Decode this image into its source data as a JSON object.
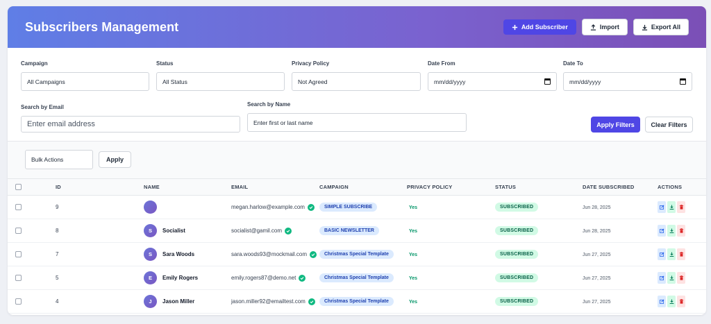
{
  "header": {
    "title": "Subscribers Management",
    "add_label": "Add Subscriber",
    "import_label": "Import",
    "export_label": "Export All"
  },
  "filters": {
    "campaign_label": "Campaign",
    "campaign_value": "All Campaigns",
    "status_label": "Status",
    "status_value": "All Status",
    "privacy_label": "Privacy Policy",
    "privacy_value": "Not Agreed",
    "date_from_label": "Date From",
    "date_from_value": "mm/dd/yyyy",
    "date_to_label": "Date To",
    "date_to_value": "mm/dd/yyyy",
    "email_label": "Search by Email",
    "email_placeholder": "Enter email address",
    "name_label": "Search by Name",
    "name_placeholder": "Enter first or last name",
    "apply_label": "Apply Filters",
    "clear_label": "Clear Filters"
  },
  "bulk": {
    "select_value": "Bulk Actions",
    "apply_label": "Apply"
  },
  "table": {
    "columns": [
      "ID",
      "NAME",
      "EMAIL",
      "CAMPAIGN",
      "PRIVACY POLICY",
      "STATUS",
      "DATE SUBSCRIBED",
      "ACTIONS"
    ],
    "rows": [
      {
        "id": "9",
        "initial": "",
        "name": "",
        "email": "megan.harlow@example.com",
        "campaign": "SIMPLE SUBSCRIBE",
        "privacy": "Yes",
        "status": "SUBSCRIBED",
        "date": "Jun 28, 2025"
      },
      {
        "id": "8",
        "initial": "S",
        "name": "Socialist",
        "email": "socialist@gamil.com",
        "campaign": "BASIC NEWSLETTER",
        "privacy": "Yes",
        "status": "SUBSCRIBED",
        "date": "Jun 28, 2025"
      },
      {
        "id": "7",
        "initial": "S",
        "name": "Sara Woods",
        "email": "sara.woods93@mockmail.com",
        "campaign": "Christmas Special Template",
        "privacy": "Yes",
        "status": "SUBSCRIBED",
        "date": "Jun 27, 2025"
      },
      {
        "id": "5",
        "initial": "E",
        "name": "Emily Rogers",
        "email": "emily.rogers87@demo.net",
        "campaign": "Christmas Special Template",
        "privacy": "Yes",
        "status": "SUBSCRIBED",
        "date": "Jun 27, 2025"
      },
      {
        "id": "4",
        "initial": "J",
        "name": "Jason Miller",
        "email": "jason.miller92@emailtest.com",
        "campaign": "Christmas Special Template",
        "privacy": "Yes",
        "status": "SUBSCRIBED",
        "date": "Jun 27, 2025"
      }
    ]
  },
  "colors": {
    "primary": "#4f46e5",
    "header_start": "#5f7ee6",
    "header_end": "#7b4fb6",
    "success": "#10b981"
  },
  "icons": [
    "plus-icon",
    "upload-icon",
    "download-icon",
    "calendar-icon",
    "verified-check-icon",
    "edit-icon",
    "trash-icon"
  ]
}
